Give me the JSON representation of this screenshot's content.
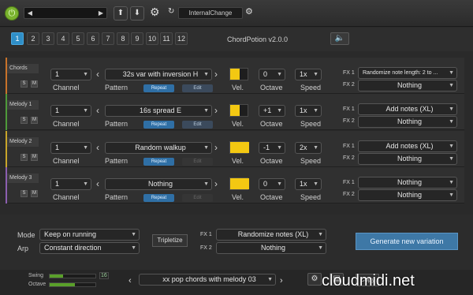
{
  "header": {
    "preset_name": "",
    "status": "InternalChange",
    "title": "ChordPotion v2.0.0"
  },
  "numbers": [
    "1",
    "2",
    "3",
    "4",
    "5",
    "6",
    "7",
    "8",
    "9",
    "10",
    "11",
    "12"
  ],
  "labels": {
    "channel": "Channel",
    "pattern": "Pattern",
    "vel": "Vel.",
    "octave": "Octave",
    "speed": "Speed",
    "repeat": "Repeat",
    "edit": "Edit",
    "fx1": "FX 1",
    "fx2": "FX 2",
    "s": "S",
    "m": "M"
  },
  "tracks": [
    {
      "name": "Chords",
      "channel": "1",
      "pattern": "32s var with inversion H",
      "octave": "0",
      "speed": "1x",
      "fx1": "Randomize note length: 2 to ...",
      "fx2": "Nothing",
      "edit_enabled": true,
      "accent": "#f3c812"
    },
    {
      "name": "Melody 1",
      "channel": "1",
      "pattern": "16s spread E",
      "octave": "+1",
      "speed": "1x",
      "fx1": "Add notes (XL)",
      "fx2": "Nothing",
      "edit_enabled": true,
      "accent": "#f3c812"
    },
    {
      "name": "Melody 2",
      "channel": "1",
      "pattern": "Random walkup",
      "octave": "-1",
      "speed": "2x",
      "fx1": "Add notes (XL)",
      "fx2": "Nothing",
      "edit_enabled": false,
      "accent": "#f3c812"
    },
    {
      "name": "Melody 3",
      "channel": "1",
      "pattern": "Nothing",
      "octave": "0",
      "speed": "1x",
      "fx1": "Nothing",
      "fx2": "Nothing",
      "edit_enabled": false,
      "accent": "#f3c812"
    }
  ],
  "velocity_levels": [
    0.5,
    0.5,
    1.0,
    1.0
  ],
  "bottom": {
    "mode_label": "Mode",
    "mode_value": "Keep on running",
    "arp_label": "Arp",
    "arp_value": "Constant direction",
    "tripletize": "Tripletize",
    "fx1_label": "FX 1",
    "fx1_value": "Randomize notes (XL)",
    "fx2_label": "FX 2",
    "fx2_value": "Nothing",
    "generate": "Generate new variation"
  },
  "footer": {
    "swing_label": "Swing",
    "octave_label": "Octave",
    "swing_value": "16",
    "progression": "xx pop chords with melody 03",
    "copy_label": "Copy"
  },
  "watermark": "cloudmidi.net",
  "colors": {
    "accent": "#2f8fc8",
    "velocity": "#f3c812",
    "power": "#7ab32e"
  }
}
